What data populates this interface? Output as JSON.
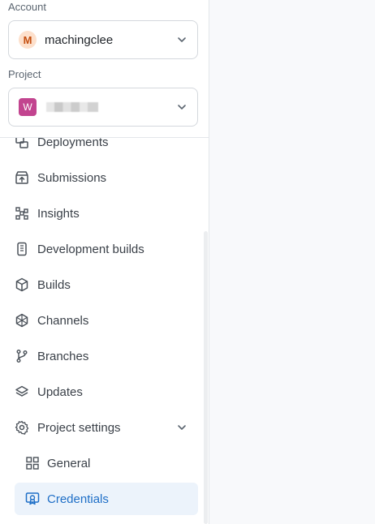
{
  "account": {
    "label": "Account",
    "avatar_letter": "M",
    "name": "machingclee"
  },
  "project": {
    "label": "Project",
    "avatar_letter": "W"
  },
  "nav": {
    "items": [
      {
        "label": "Deployments",
        "icon": "deployments-icon"
      },
      {
        "label": "Submissions",
        "icon": "submissions-icon"
      },
      {
        "label": "Insights",
        "icon": "insights-icon"
      },
      {
        "label": "Development builds",
        "icon": "device-icon"
      },
      {
        "label": "Builds",
        "icon": "cube-icon"
      },
      {
        "label": "Channels",
        "icon": "channels-icon"
      },
      {
        "label": "Branches",
        "icon": "branch-icon"
      },
      {
        "label": "Updates",
        "icon": "layers-icon"
      },
      {
        "label": "Project settings",
        "icon": "gear-icon"
      }
    ],
    "sub_items": [
      {
        "label": "General",
        "icon": "grid-icon"
      },
      {
        "label": "Credentials",
        "icon": "certificate-icon",
        "active": true
      }
    ]
  },
  "colors": {
    "accent": "#1f6fc7",
    "active_bg": "#ecf3fb",
    "account_avatar": "#fde0cc",
    "project_avatar": "#c2448f"
  }
}
